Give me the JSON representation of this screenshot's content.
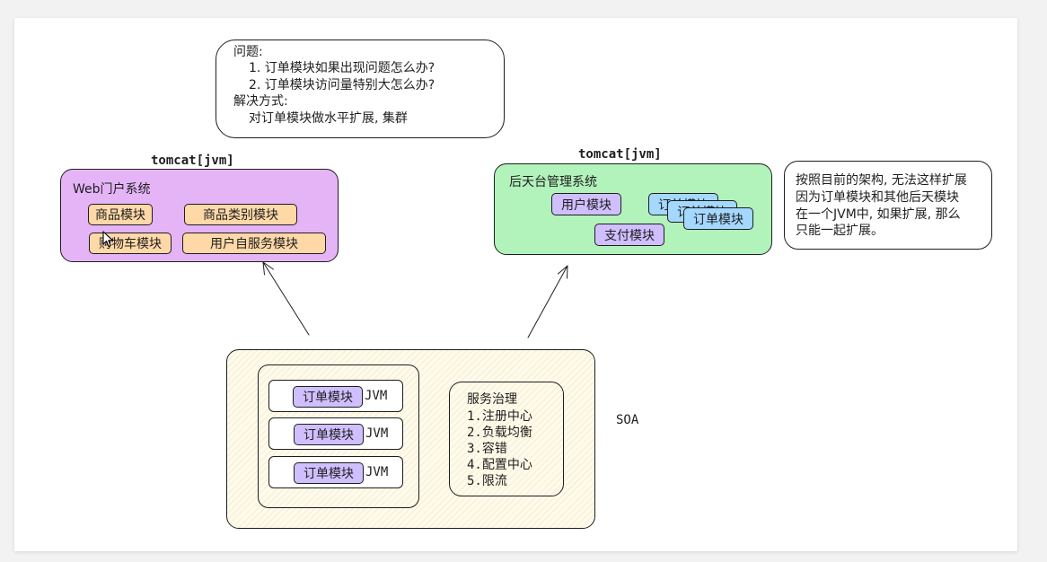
{
  "problem_note": {
    "heading": "问题:",
    "q1": "1. 订单模块如果出现问题怎么办?",
    "q2": "2. 订单模块访问量特别大怎么办?",
    "solution_heading": "解决方式:",
    "solution": "对订单模块做水平扩展, 集群"
  },
  "web_portal": {
    "tomcat_label": "tomcat[jvm]",
    "title": "Web门户系统",
    "modules": {
      "product": "商品模块",
      "category": "商品类别模块",
      "cart": "购物车模块",
      "user_service": "用户自服务模块"
    }
  },
  "backend": {
    "tomcat_label": "tomcat[jvm]",
    "title": "后天台管理系统",
    "modules": {
      "user": "用户模块",
      "order_back2": "订单模块",
      "order_back1": "订单模块",
      "order": "订单模块",
      "payment": "支付模块"
    }
  },
  "side_note": {
    "line1": "按照目前的架构, 无法这样扩展",
    "line2": "因为订单模块和其他后天模块",
    "line3": "在一个JVM中, 如果扩展, 那么",
    "line4": "只能一起扩展。"
  },
  "soa": {
    "label": "SOA",
    "jvm_rows": [
      {
        "module": "订单模块",
        "jvm": "JVM"
      },
      {
        "module": "订单模块",
        "jvm": "JVM"
      },
      {
        "module": "订单模块",
        "jvm": "JVM"
      }
    ],
    "governance": {
      "title": "服务治理",
      "items": [
        "1.注册中心",
        "2.负载均衡",
        "3.容错",
        "4.配置中心",
        "5.限流"
      ]
    }
  },
  "colors": {
    "web_portal_bg": "#e5b4f7",
    "backend_bg": "#b2f2bb",
    "module_orange": "#ffd8a8",
    "module_purple": "#d0bfff",
    "module_blue": "#a5d8ff",
    "soa_bg": "#fffbea"
  }
}
